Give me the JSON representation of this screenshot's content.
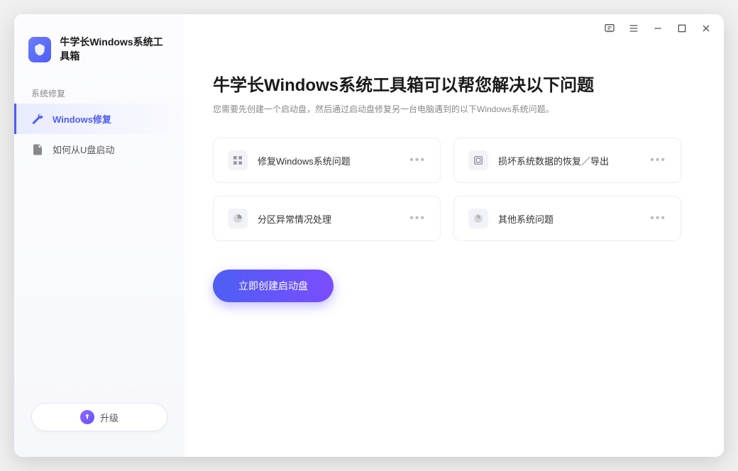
{
  "brand": {
    "title": "牛学长Windows系统工具箱"
  },
  "sidebar": {
    "section": "系统修复",
    "items": [
      {
        "label": "Windows修复"
      },
      {
        "label": "如何从U盘启动"
      }
    ]
  },
  "upgrade": {
    "label": "升级"
  },
  "main": {
    "title": "牛学长Windows系统工具箱可以帮您解决以下问题",
    "subtitle": "您需要先创建一个启动盘，然后通过启动盘修复另一台电脑遇到的以下Windows系统问题。"
  },
  "cards": [
    {
      "label": "修复Windows系统问题"
    },
    {
      "label": "损坏系统数据的恢复／导出"
    },
    {
      "label": "分区异常情况处理"
    },
    {
      "label": "其他系统问题"
    }
  ],
  "cta": {
    "label": "立即创建启动盘"
  }
}
